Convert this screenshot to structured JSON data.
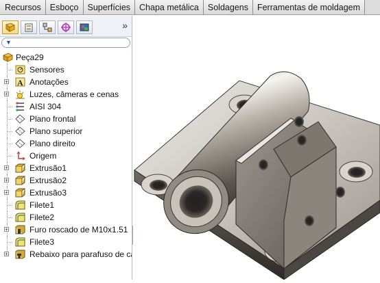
{
  "command_tabs": [
    "Recursos",
    "Esboço",
    "Superfícies",
    "Chapa metálica",
    "Soldagens",
    "Ferramentas de moldagem"
  ],
  "panel_toolbar": {
    "icons": [
      "feature-manager-icon",
      "property-manager-icon",
      "configuration-manager-icon",
      "dimxpert-icon",
      "display-manager-icon"
    ],
    "more": "»"
  },
  "tree": {
    "root": "Peça29",
    "items": [
      {
        "label": "Sensores",
        "icon": "sensor-icon",
        "expandable": false
      },
      {
        "label": "Anotações",
        "icon": "annotation-icon",
        "expandable": true
      },
      {
        "label": "Luzes, câmeras e cenas",
        "icon": "lights-icon",
        "expandable": true
      },
      {
        "label": "AISI 304",
        "icon": "material-icon",
        "expandable": false
      },
      {
        "label": "Plano frontal",
        "icon": "plane-icon",
        "expandable": false
      },
      {
        "label": "Plano superior",
        "icon": "plane-icon",
        "expandable": false
      },
      {
        "label": "Plano direito",
        "icon": "plane-icon",
        "expandable": false
      },
      {
        "label": "Origem",
        "icon": "origin-icon",
        "expandable": false
      },
      {
        "label": "Extrusão1",
        "icon": "extrude-icon",
        "expandable": true
      },
      {
        "label": "Extrusão2",
        "icon": "extrude-icon",
        "expandable": true
      },
      {
        "label": "Extrusão3",
        "icon": "extrude-icon",
        "expandable": true
      },
      {
        "label": "Filete1",
        "icon": "fillet-icon",
        "expandable": false
      },
      {
        "label": "Filete2",
        "icon": "fillet-icon",
        "expandable": false
      },
      {
        "label": "Furo roscado de M10x1.51",
        "icon": "hole-icon",
        "expandable": true
      },
      {
        "label": "Filete3",
        "icon": "fillet-icon",
        "expandable": false
      },
      {
        "label": "Rebaixo para parafuso de ca",
        "icon": "hole-icon",
        "expandable": true
      }
    ]
  }
}
